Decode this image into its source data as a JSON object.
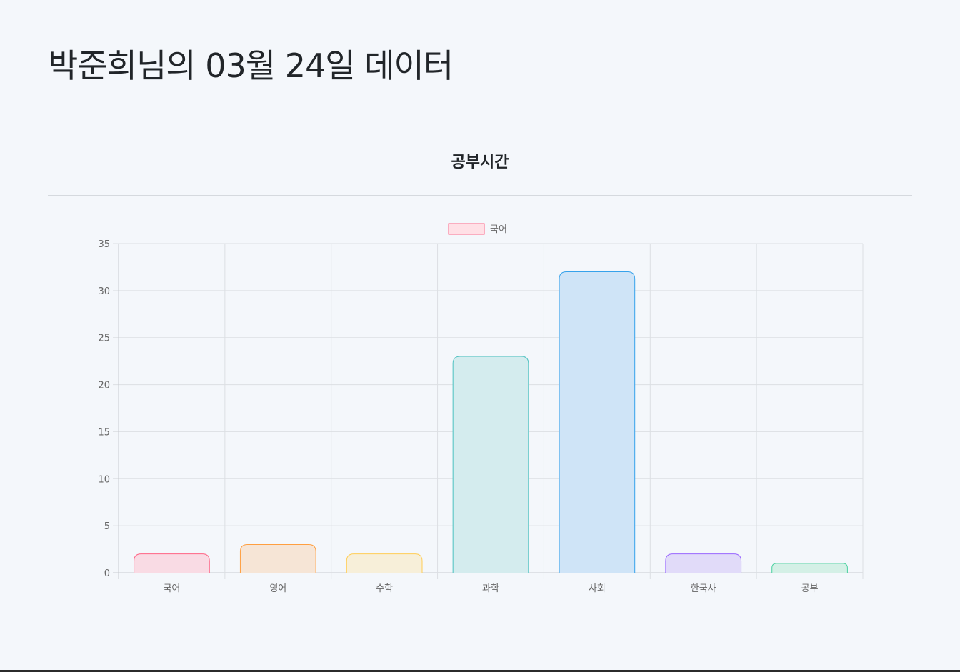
{
  "header": {
    "title": "박준희님의 03월 24일 데이터"
  },
  "section": {
    "title": "공부시간"
  },
  "chart_data": {
    "type": "bar",
    "legend": {
      "label": "국어",
      "position": "top",
      "fill": "#ffe0e6",
      "stroke": "#ff6384"
    },
    "categories": [
      "국어",
      "영어",
      "수학",
      "과학",
      "사회",
      "한국사",
      "공부"
    ],
    "values": [
      2,
      3,
      2,
      23,
      32,
      2,
      1
    ],
    "ylim": [
      0,
      35
    ],
    "yticks": [
      0,
      5,
      10,
      15,
      20,
      25,
      30,
      35
    ],
    "grid": true,
    "colors": [
      {
        "fill": "#f9dbe4",
        "stroke": "#ff6384"
      },
      {
        "fill": "#f6e5d6",
        "stroke": "#ff9f40"
      },
      {
        "fill": "#f7efd9",
        "stroke": "#ffcd56"
      },
      {
        "fill": "#d4ecee",
        "stroke": "#4bc0c0"
      },
      {
        "fill": "#cfe4f7",
        "stroke": "#36a2eb"
      },
      {
        "fill": "#e1dbf9",
        "stroke": "#9966ff"
      },
      {
        "fill": "#d4f0e6",
        "stroke": "#4ad1a0"
      }
    ]
  }
}
